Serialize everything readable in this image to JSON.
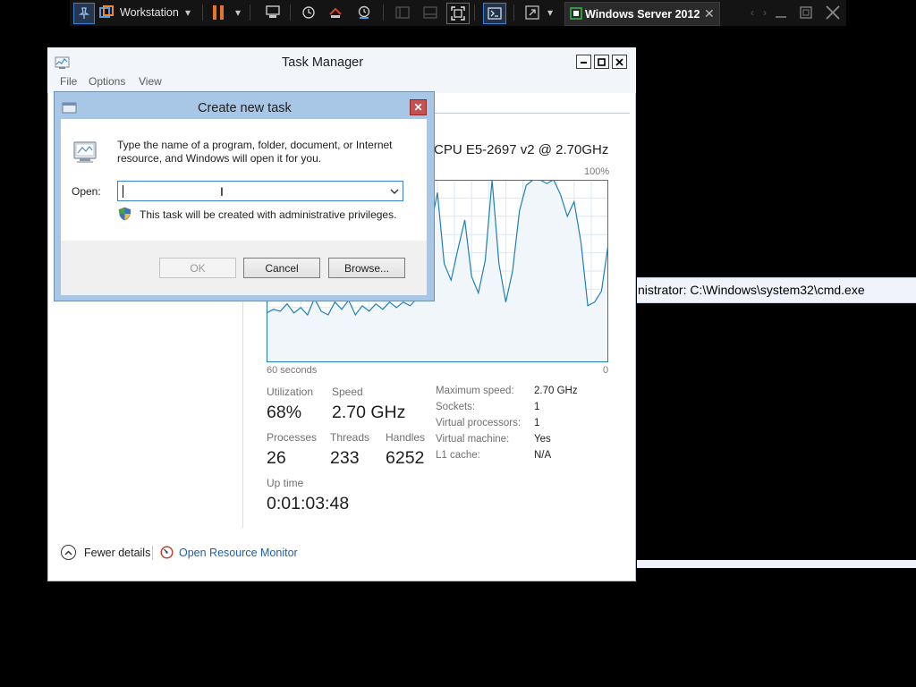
{
  "vm_toolbar": {
    "product": "Workstation",
    "vm_tab_title": "Windows Server 2012",
    "tab_close_glyph": "✕",
    "dropdown_glyph": "▾",
    "nav_left_glyph": "‹",
    "nav_right_glyph": "›",
    "accent_pause": "#e8742a",
    "accent_console": "#3f7fd0"
  },
  "cmd_window": {
    "title": "nistrator: C:\\Windows\\system32\\cmd.exe"
  },
  "task_manager": {
    "title": "Task Manager",
    "menu": [
      "File",
      "Options",
      "View"
    ],
    "cpu_name": "CPU E5-2697 v2 @ 2.70GHz",
    "chart": {
      "top_label": "100%",
      "left_label": "60 seconds",
      "right_label": "0",
      "line_color": "#1f7fb5",
      "fill_color": "#f1f6fb"
    },
    "stats": {
      "utilization": {
        "label": "Utilization",
        "value": "68%"
      },
      "speed": {
        "label": "Speed",
        "value": "2.70 GHz"
      },
      "processes": {
        "label": "Processes",
        "value": "26"
      },
      "threads": {
        "label": "Threads",
        "value": "233"
      },
      "handles": {
        "label": "Handles",
        "value": "6252"
      },
      "uptime": {
        "label": "Up time",
        "value": "0:01:03:48"
      }
    },
    "specs": [
      {
        "key": "Maximum speed:",
        "value": "2.70 GHz"
      },
      {
        "key": "Sockets:",
        "value": "1"
      },
      {
        "key": "Virtual processors:",
        "value": "1"
      },
      {
        "key": "Virtual machine:",
        "value": "Yes"
      },
      {
        "key": "L1 cache:",
        "value": "N/A"
      }
    ],
    "footer": {
      "fewer_details": "Fewer details",
      "open_resource_monitor": "Open Resource Monitor"
    }
  },
  "dialog": {
    "title": "Create new task",
    "description": "Type the name of a program, folder, document, or Internet resource, and Windows will open it for you.",
    "open_label": "Open:",
    "input_value": "",
    "admin_note": "This task will be created with administrative privileges.",
    "ok_label": "OK",
    "cancel_label": "Cancel",
    "browse_label": "Browse...",
    "close_glyph": "✕"
  },
  "chart_data": {
    "type": "line",
    "title": "",
    "xlabel": "",
    "ylabel": "",
    "xlim": [
      60,
      0
    ],
    "ylim": [
      0,
      100
    ],
    "grid": true,
    "x_range_label": "60 seconds",
    "series": [
      {
        "values": [
          27,
          29,
          28,
          32,
          27,
          30,
          26,
          35,
          28,
          26,
          33,
          29,
          34,
          26,
          31,
          28,
          32,
          29,
          33,
          30,
          33,
          31,
          35,
          57,
          74,
          93,
          54,
          45,
          62,
          78,
          47,
          38,
          56,
          100,
          54,
          33,
          50,
          83,
          97,
          100,
          100,
          98,
          100,
          92,
          80,
          88,
          66,
          31,
          33,
          39,
          65
        ]
      }
    ]
  }
}
